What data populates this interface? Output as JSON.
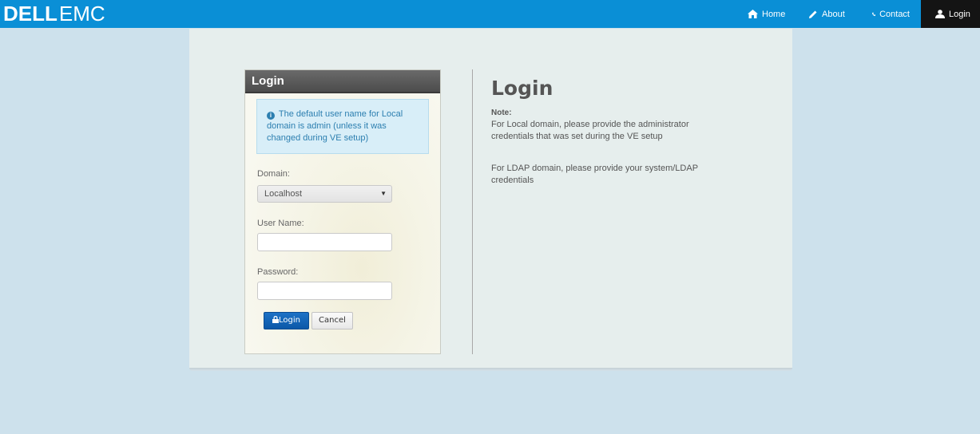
{
  "brand": {
    "part1": "DELL",
    "part2": "EMC"
  },
  "nav": {
    "home": "Home",
    "about": "About",
    "contact": "Contact",
    "login": "Login"
  },
  "login_box": {
    "title": "Login",
    "alert": "The default user name for Local domain is admin (unless it was changed during VE setup)",
    "domain_label": "Domain:",
    "domain_value": "Localhost",
    "username_label": "User Name:",
    "username_value": "",
    "password_label": "Password:",
    "password_value": "",
    "login_button": "Login",
    "cancel_button": "Cancel"
  },
  "info": {
    "title": "Login",
    "note_label": "Note:",
    "local_note": "For Local domain, please provide the administrator credentials that was set during the VE setup",
    "ldap_note": "For LDAP domain, please provide your system/LDAP credentials"
  },
  "colors": {
    "navbar": "#0a8fd6",
    "background": "#cde1ec",
    "login_button": "#0b58a8",
    "active_nav": "#141414"
  }
}
